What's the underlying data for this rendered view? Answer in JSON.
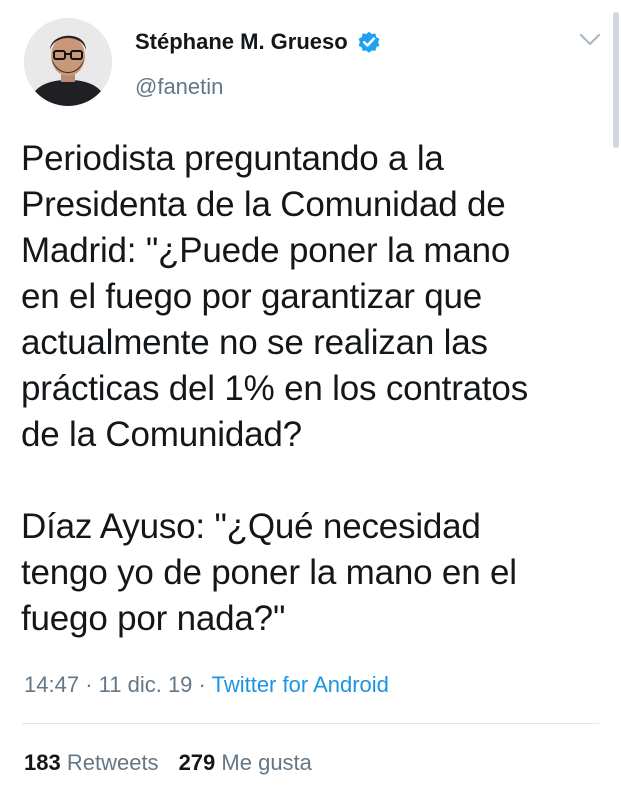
{
  "user": {
    "display_name": "Stéphane M. Grueso",
    "handle": "@fanetin",
    "verified": true
  },
  "tweet": {
    "text": "Periodista preguntando a la\nPresidenta de la Comunidad de\nMadrid: \"¿Puede poner la mano\nen el fuego por garantizar que\nactualmente no se realizan las\nprácticas del 1% en los contratos\nde la Comunidad?\n\nDíaz Ayuso: \"¿Qué necesidad\ntengo yo de poner la mano en el\nfuego por nada?\"",
    "time": "14:47",
    "separator": "·",
    "date": "11 dic. 19",
    "source": "Twitter for Android"
  },
  "stats": {
    "retweets_count": "183",
    "retweets_label": "Retweets",
    "likes_count": "279",
    "likes_label": "Me gusta"
  },
  "colors": {
    "text": "#14171a",
    "secondary": "#657786",
    "link": "#1b95e0",
    "verified": "#1da1f2"
  },
  "icons": {
    "verified": "verified-badge-icon",
    "menu": "chevron-down-icon"
  }
}
